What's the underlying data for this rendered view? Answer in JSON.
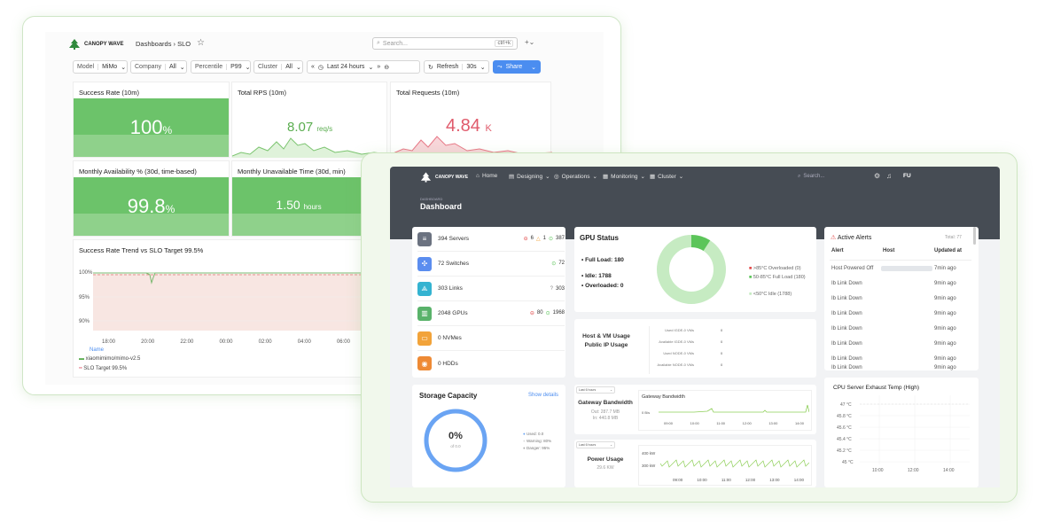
{
  "back": {
    "brand": "CANOPY WAVE",
    "breadcrumb": "Dashboards › SLO",
    "search_placeholder": "Search...",
    "search_shortcut": "ctrl+k",
    "filters": [
      {
        "key": "Model",
        "value": "MiMo"
      },
      {
        "key": "Company",
        "value": "All"
      },
      {
        "key": "Percentile",
        "value": "P99"
      },
      {
        "key": "Cluster",
        "value": "All"
      }
    ],
    "time_range": "Last 24 hours",
    "refresh_label": "Refresh",
    "refresh_interval": "30s",
    "share_label": "Share",
    "panels": {
      "success_rate": {
        "title": "Success Rate (10m)",
        "value": "100",
        "unit": "%"
      },
      "total_rps": {
        "title": "Total RPS (10m)",
        "value": "8.07",
        "unit": "req/s"
      },
      "total_requests": {
        "title": "Total Requests (10m)",
        "value": "4.84",
        "unit": "K"
      },
      "monthly_availability": {
        "title": "Monthly Availability % (30d, time-based)",
        "value": "99.8",
        "unit": "%"
      },
      "monthly_unavailable": {
        "title": "Monthly Unavailable Time (30d, min)",
        "value": "1.50",
        "unit": "hours"
      }
    },
    "trend": {
      "title": "Success Rate Trend vs SLO Target 99.5%",
      "y_ticks": [
        "100%",
        "95%",
        "90%"
      ],
      "x_ticks": [
        "18:00",
        "20:00",
        "22:00",
        "00:00",
        "02:00",
        "04:00",
        "06:00"
      ],
      "legend_header": "Name",
      "legend": [
        "xiaomimimo/mimo-v2.5",
        "SLO Target 99.5%"
      ]
    }
  },
  "front": {
    "brand": "CANOPY WAVE",
    "nav": [
      "Home",
      "Designing",
      "Operations",
      "Monitoring",
      "Cluster"
    ],
    "search_placeholder": "Search...",
    "user_initials": "FU",
    "breadcrumb_small": "DASHBOARD",
    "page_title": "Dashboard",
    "summary": [
      {
        "label": "394 Servers",
        "a": "6",
        "b": "1",
        "c": "387",
        "color": "#6b7280"
      },
      {
        "label": "72 Switches",
        "c": "72",
        "color": "#5b8def"
      },
      {
        "label": "303 Links",
        "d": "303",
        "color": "#34b3d1"
      },
      {
        "label": "2048 GPUs",
        "a": "80",
        "c": "1968",
        "color": "#59b26a"
      },
      {
        "label": "0 NVMes",
        "color": "#f2a33a"
      },
      {
        "label": "0 HDDs",
        "color": "#ee8a35"
      }
    ],
    "gpu": {
      "title": "GPU Status",
      "full_load_label": "Full Load:",
      "full_load": "180",
      "idle_label": "Idle:",
      "idle": "1788",
      "overloaded_label": "Overloaded:",
      "overloaded": "0",
      "legend": [
        ">85°C Overloaded (0)",
        "50-85°C Full Load (180)",
        "<50°C Idle (1788)"
      ],
      "colors": [
        "#e24b4b",
        "#5cc55a",
        "#c6ebc2"
      ]
    },
    "host_vm": {
      "title_1": "Host & VM Usage",
      "title_2": "Public IP Usage",
      "rows": [
        {
          "label": "Used IGDE-0 VMs",
          "value": "0"
        },
        {
          "label": "Available IGDE-0 VMs",
          "value": "0"
        },
        {
          "label": "Used NODE-0 VMs",
          "value": "0"
        },
        {
          "label": "Available NODE-0 VMs",
          "value": "0"
        }
      ]
    },
    "alerts": {
      "title": "Active Alerts",
      "total": "Total: 77",
      "columns": [
        "Alert",
        "Host",
        "Updated at"
      ],
      "rows": [
        {
          "alert": "Host Powered Off",
          "updated": "7min ago"
        },
        {
          "alert": "Ib Link Down",
          "updated": "9min ago"
        },
        {
          "alert": "Ib Link Down",
          "updated": "9min ago"
        },
        {
          "alert": "Ib Link Down",
          "updated": "9min ago"
        },
        {
          "alert": "Ib Link Down",
          "updated": "9min ago"
        },
        {
          "alert": "Ib Link Down",
          "updated": "9min ago"
        },
        {
          "alert": "Ib Link Down",
          "updated": "9min ago"
        },
        {
          "alert": "Ib Link Down",
          "updated": "9min ago"
        }
      ]
    },
    "storage": {
      "title": "Storage Capacity",
      "link": "Show details",
      "percent": "0%",
      "sub": "of 0.0",
      "legend": [
        "Used: 0.0",
        "Warning: 80%",
        "Danger: 95%"
      ]
    },
    "gateway": {
      "range": "Last 6 hours",
      "title": "Gateway Bandwidth",
      "out": "Out: 287.7 MB",
      "in": "In: 440.8 MB",
      "chart_title": "Gateway Bandwidth",
      "y_tick": "0 B/s",
      "x_ticks": [
        "09:00",
        "10:00",
        "11:00",
        "12:00",
        "13:00",
        "14:00"
      ]
    },
    "power": {
      "range": "Last 6 hours",
      "title": "Power Usage",
      "value": "29.6 KW",
      "y_ticks": [
        "400 kW",
        "300 kW"
      ],
      "x_ticks": [
        "09:00",
        "10:00",
        "11:00",
        "12:00",
        "13:00",
        "14:00"
      ]
    },
    "cpu_temp": {
      "title": "CPU Server Exhaust Temp (High)",
      "y_ticks": [
        "47 °C",
        "45.8 °C",
        "45.6 °C",
        "45.4 °C",
        "45.2 °C",
        "45 °C"
      ],
      "x_ticks": [
        "10:00",
        "12:00",
        "14:00"
      ]
    }
  }
}
